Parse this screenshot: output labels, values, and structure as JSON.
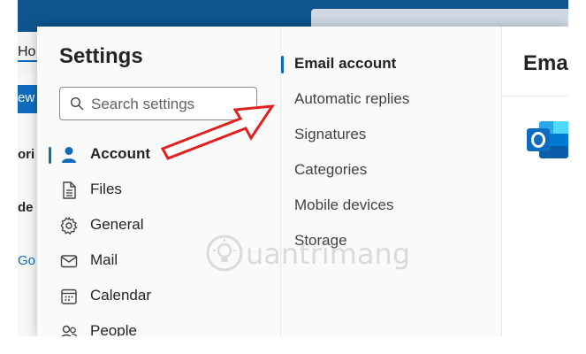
{
  "background": {
    "tab_fragment": "Ho",
    "ribbon_fragment": "ew",
    "frag_1": "ori",
    "frag_2": "de",
    "frag_3": "Go"
  },
  "settings": {
    "title": "Settings",
    "search_placeholder": "Search settings",
    "nav_items": [
      {
        "label": "Account",
        "icon": "person-icon",
        "active": true
      },
      {
        "label": "Files",
        "icon": "file-icon",
        "active": false
      },
      {
        "label": "General",
        "icon": "gear-icon",
        "active": false
      },
      {
        "label": "Mail",
        "icon": "mail-icon",
        "active": false
      },
      {
        "label": "Calendar",
        "icon": "calendar-icon",
        "active": false
      },
      {
        "label": "People",
        "icon": "people-icon",
        "active": false
      }
    ],
    "sub_items": [
      {
        "label": "Email account",
        "active": true
      },
      {
        "label": "Automatic replies",
        "active": false
      },
      {
        "label": "Signatures",
        "active": false
      },
      {
        "label": "Categories",
        "active": false
      },
      {
        "label": "Mobile devices",
        "active": false
      },
      {
        "label": "Storage",
        "active": false
      }
    ],
    "main_title": "Ema"
  },
  "watermark_text": "uantrimang",
  "colors": {
    "accent": "#0f6cbd",
    "annotation_arrow": "#e02020",
    "top_bar": "#0f548c"
  }
}
